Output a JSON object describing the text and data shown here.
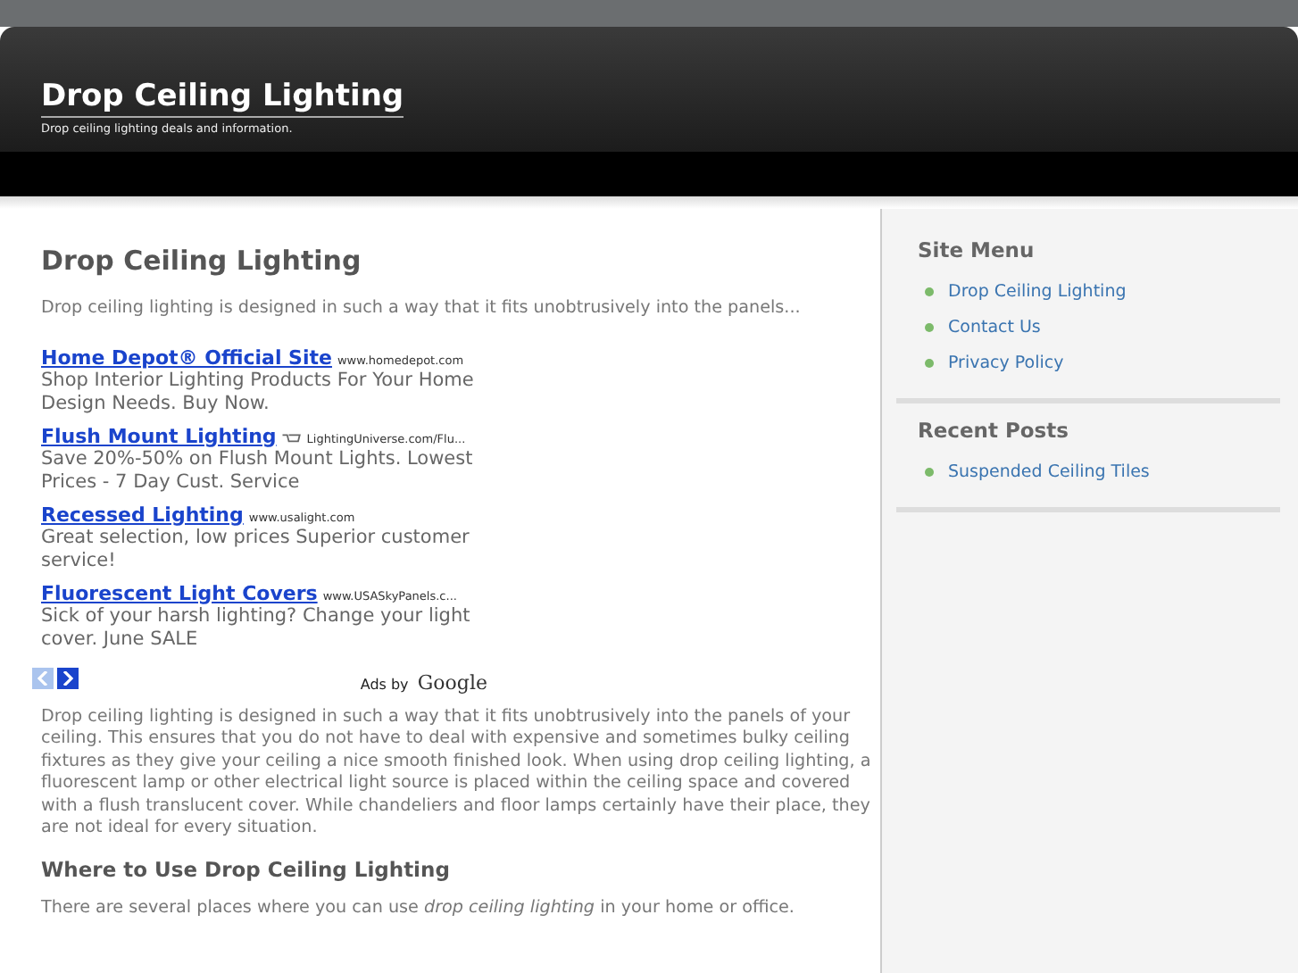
{
  "header": {
    "title": "Drop Ceiling Lighting",
    "tagline": "Drop ceiling lighting deals and information."
  },
  "post": {
    "title": "Drop Ceiling Lighting",
    "excerpt": "Drop ceiling lighting is designed in such a way that it fits unobtrusively into the panels...",
    "ads": [
      {
        "title": "Home Depot® Official Site",
        "url": "www.homedepot.com",
        "cart": false,
        "text": "Shop Interior Lighting Products For Your Home Design Needs. Buy Now."
      },
      {
        "title": "Flush Mount Lighting",
        "url": "LightingUniverse.com/Flu...",
        "cart": true,
        "text": "Save 20%-50% on Flush Mount Lights. Lowest Prices - 7 Day Cust. Service"
      },
      {
        "title": "Recessed Lighting",
        "url": "www.usalight.com",
        "cart": false,
        "text": "Great selection, low prices Superior customer service!"
      },
      {
        "title": "Fluorescent Light Covers",
        "url": "www.USASkyPanels.c...",
        "cart": false,
        "text": "Sick of your harsh lighting? Change your light cover. June SALE"
      }
    ],
    "ads_prev_disabled": true,
    "ads_by": "Ads by",
    "ads_brand": "Google",
    "body": "Drop ceiling lighting is designed in such a way that it fits unobtrusively into the panels of your ceiling. This ensures that you do not have to deal with expensive and sometimes bulky ceiling fixtures as they give your ceiling a nice smooth finished look. When using drop ceiling lighting, a fluorescent lamp or other electrical light source is placed within the ceiling space and covered with a flush translucent cover. While chandeliers and floor lamps certainly have their place, they are not ideal for every situation.",
    "subheading": "Where to Use Drop Ceiling Lighting",
    "body2": "There are several places where you can use *drop ceiling lighting* in your home or office."
  },
  "sidebar": [
    {
      "title": "Site Menu",
      "items": [
        "Drop Ceiling Lighting",
        "Contact Us",
        "Privacy Policy"
      ]
    },
    {
      "title": "Recent Posts",
      "items": [
        "Suspended Ceiling Tiles"
      ]
    }
  ]
}
